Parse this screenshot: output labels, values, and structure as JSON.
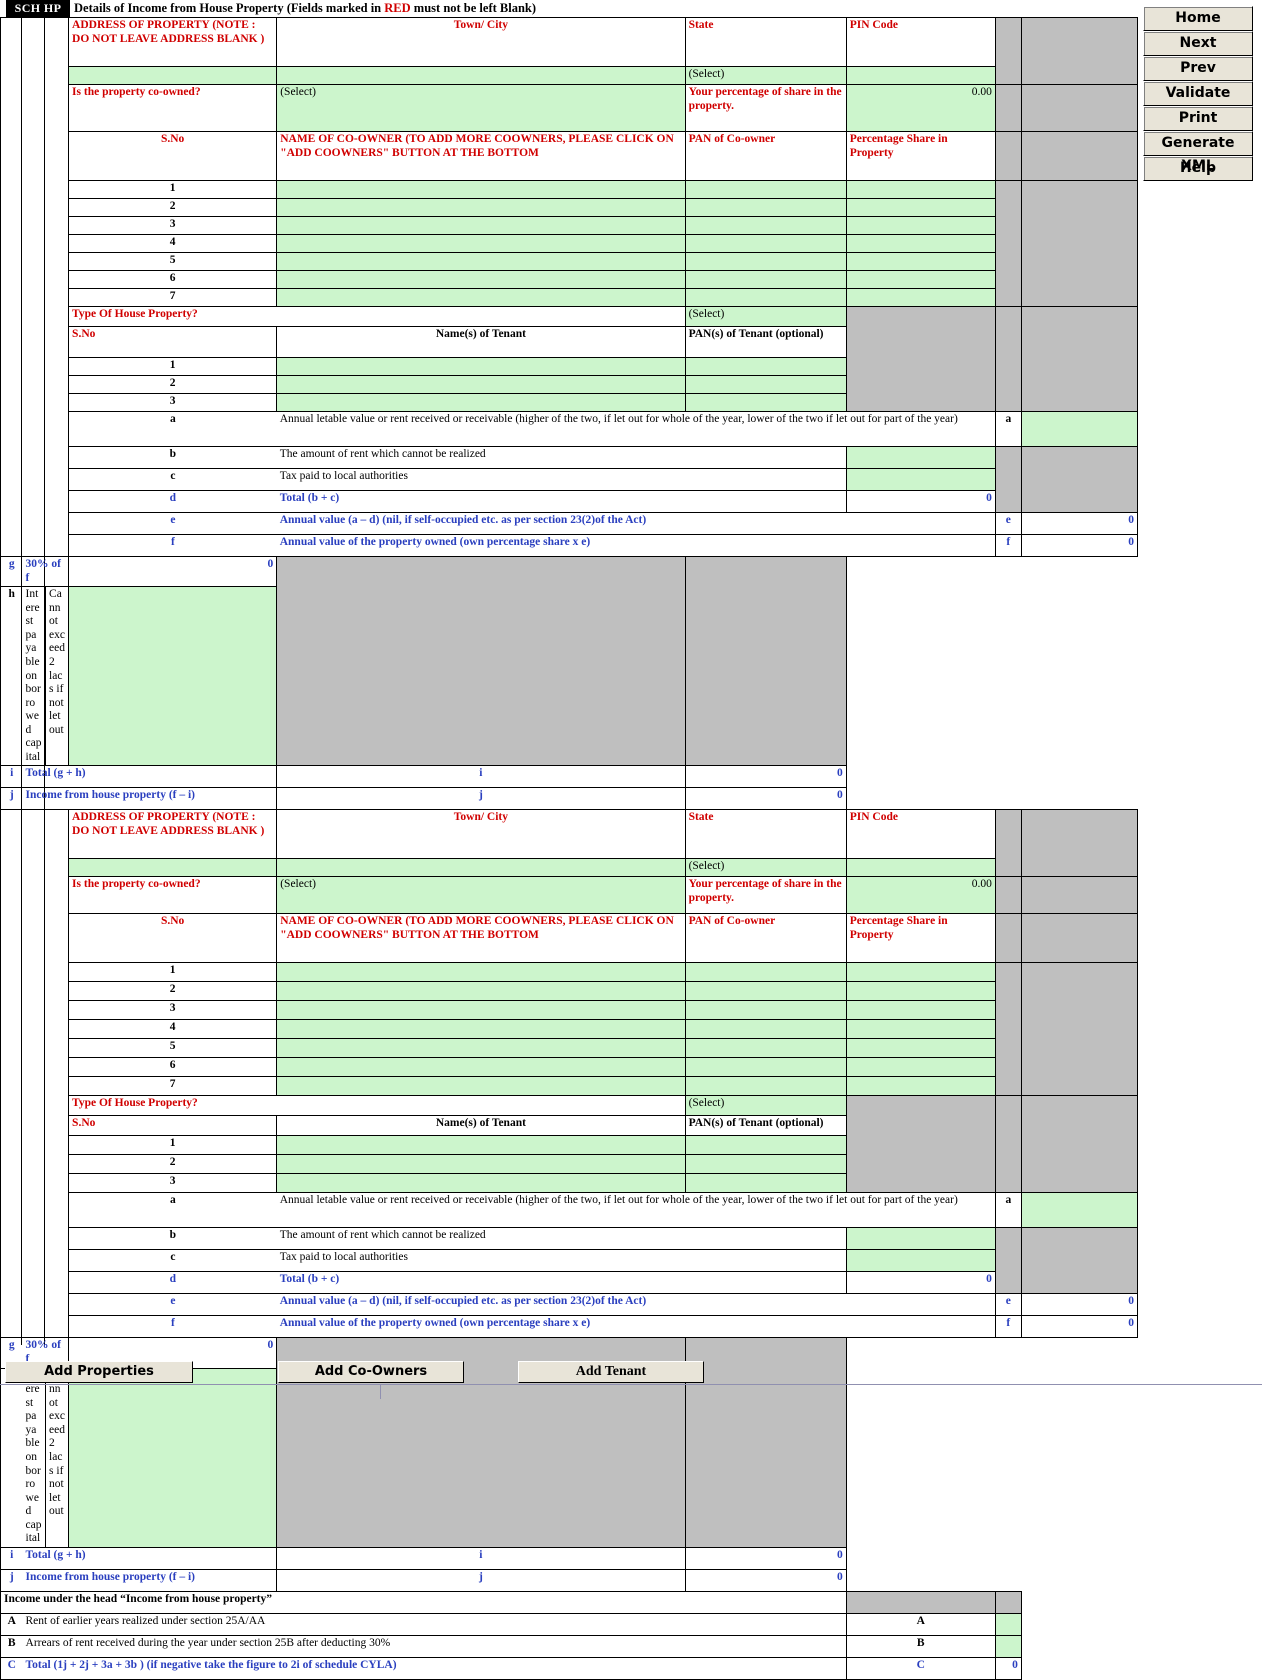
{
  "sheet": {
    "tag": "SCH HP",
    "title_pre": "Details of Income from House Property (Fields marked in ",
    "title_red": "RED",
    "title_post": " must not be left Blank)"
  },
  "side_buttons": [
    {
      "label": "Home"
    },
    {
      "label": "Next"
    },
    {
      "label": "Prev"
    },
    {
      "label": "Validate"
    },
    {
      "label": "Print"
    },
    {
      "label": "Generate XML"
    },
    {
      "label": "Help"
    }
  ],
  "bottom_buttons": [
    {
      "label": "Add Properties"
    },
    {
      "label": "Add Co-Owners"
    },
    {
      "label": "Add Tenant"
    }
  ],
  "labels": {
    "address": "ADDRESS OF PROPERTY  (NOTE : DO NOT LEAVE ADDRESS BLANK )",
    "town_city": "Town/ City",
    "state": "State",
    "pin_code": "PIN Code",
    "select": "(Select)",
    "co_owned_q": "Is the property co-owned?",
    "percentage_share_q": "Your percentage of share in the property.",
    "percentage_share_value": "0.00",
    "sno": "S.No",
    "co_owner_name": "NAME OF CO-OWNER (TO ADD MORE COOWNERS, PLEASE CLICK ON \"ADD COOWNERS\" BUTTON AT THE BOTTOM",
    "pan_co_owner": "PAN of Co-owner",
    "pct_share_property": "Percentage  Share in Property",
    "type_of_house": "Type Of House Property?",
    "tenant_names": "Name(s) of Tenant",
    "tenant_pans": "PAN(s) of Tenant (optional)",
    "cannot_exceed": "Cannot exceed 2 lacs if not let out"
  },
  "coowner_rows": [
    "1",
    "2",
    "3",
    "4",
    "5",
    "6",
    "7"
  ],
  "tenant_rows": [
    "1",
    "2",
    "3"
  ],
  "income_rows": [
    {
      "key": "a",
      "text": "Annual letable value or rent received or receivable (higher of the two, if let out for whole of the year, lower of the two if let out for part of the year)",
      "style": "black"
    },
    {
      "key": "b",
      "text": "The amount of rent which cannot be realized",
      "style": "black"
    },
    {
      "key": "c",
      "text": "Tax paid to local authorities",
      "style": "black"
    },
    {
      "key": "d",
      "text": "Total (b + c)",
      "style": "blue",
      "value": "0"
    },
    {
      "key": "e",
      "text": "Annual value (a – d) (nil, if self-occupied etc. as per section 23(2)of the Act)",
      "style": "blue",
      "value": "0"
    },
    {
      "key": "f",
      "text": "Annual value of the property owned (own percentage share x e)",
      "style": "blue",
      "value": "0"
    },
    {
      "key": "g",
      "text": "30% of f",
      "style": "blue",
      "value": "0"
    },
    {
      "key": "h",
      "text": "Interest payable on borrowed capital",
      "style": "black"
    },
    {
      "key": "i",
      "text": "Total (g + h)",
      "style": "blue",
      "value": "0"
    },
    {
      "key": "j",
      "text": "Income from house property (f – i)",
      "style": "blue",
      "value": "0"
    }
  ],
  "summary": {
    "heading": "Income under the head “Income from house property”",
    "rows": [
      {
        "key": "A",
        "text": "Rent of earlier years realized under section 25A/AA",
        "style": "black",
        "input": true
      },
      {
        "key": "B",
        "text": "Arrears of rent received during the year under section 25B after deducting 30%",
        "style": "black",
        "input": true
      },
      {
        "key": "C",
        "text": "Total (1j + 2j + 3a + 3b ) (if negative take the figure to 2i of schedule CYLA)",
        "style": "blue",
        "value": "0"
      }
    ]
  },
  "colors": {
    "input_green": "#ccf5cc",
    "locked_grey": "#bfbfbf",
    "required_red": "#d00000",
    "computed_blue": "#2a3fbf",
    "button_face": "#e8e4d8"
  }
}
